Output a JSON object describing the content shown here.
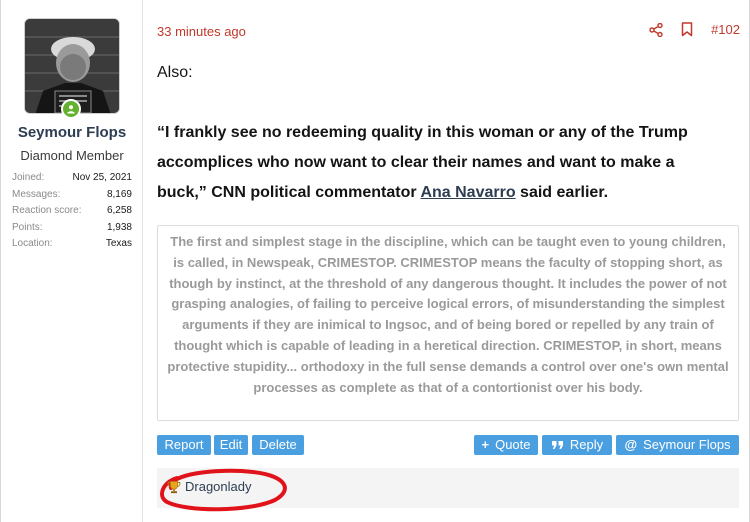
{
  "user": {
    "username": "Seymour Flops",
    "title": "Diamond Member",
    "online": true,
    "stats": [
      {
        "label": "Joined:",
        "value": "Nov 25, 2021"
      },
      {
        "label": "Messages:",
        "value": "8,169"
      },
      {
        "label": "Reaction score:",
        "value": "6,258"
      },
      {
        "label": "Points:",
        "value": "1,938"
      },
      {
        "label": "Location:",
        "value": "Texas"
      }
    ]
  },
  "post": {
    "timestamp": "33 minutes ago",
    "post_number": "#102",
    "intro": "Also:",
    "quote_before_link": "“I frankly see no redeeming quality in this woman or any of the Trump accomplices who now want to clear their names and want to make a buck,”",
    "quote_after_quote": " CNN political commentator ",
    "link_text": "Ana Navarro",
    "quote_tail": " said earlier.",
    "blockquote": "The first and simplest stage in the discipline, which can be taught even to young children, is called, in Newspeak, CRIMESTOP. CRIMESTOP means the faculty of stopping short, as though by instinct, at the threshold of any dangerous thought. It includes the power of not grasping analogies, of failing to perceive logical errors, of misunderstanding the simplest arguments if they are inimical to Ingsoc, and of being bored or repelled by any train of thought which is capable of leading in a heretical direction. CRIMESTOP, in short, means protective stupidity... orthodoxy in the full sense demands a control over one's own mental processes as complete as that of a contortionist over his body."
  },
  "actions": {
    "report": "Report",
    "edit": "Edit",
    "delete": "Delete",
    "quote": "Quote",
    "reply": "Reply",
    "mention": "Seymour Flops"
  },
  "reactions": {
    "users": "Dragonlady"
  },
  "colors": {
    "accent_red": "#c0392b",
    "button_blue": "#4a9fe0",
    "online_green": "#63b12f",
    "annotation_red": "#e0131a"
  },
  "icons": {
    "share": "share-icon",
    "bookmark": "bookmark-icon",
    "trophy": "trophy-icon",
    "plus": "plus-icon",
    "quote_marks": "quote-marks-icon",
    "at": "at-icon"
  }
}
